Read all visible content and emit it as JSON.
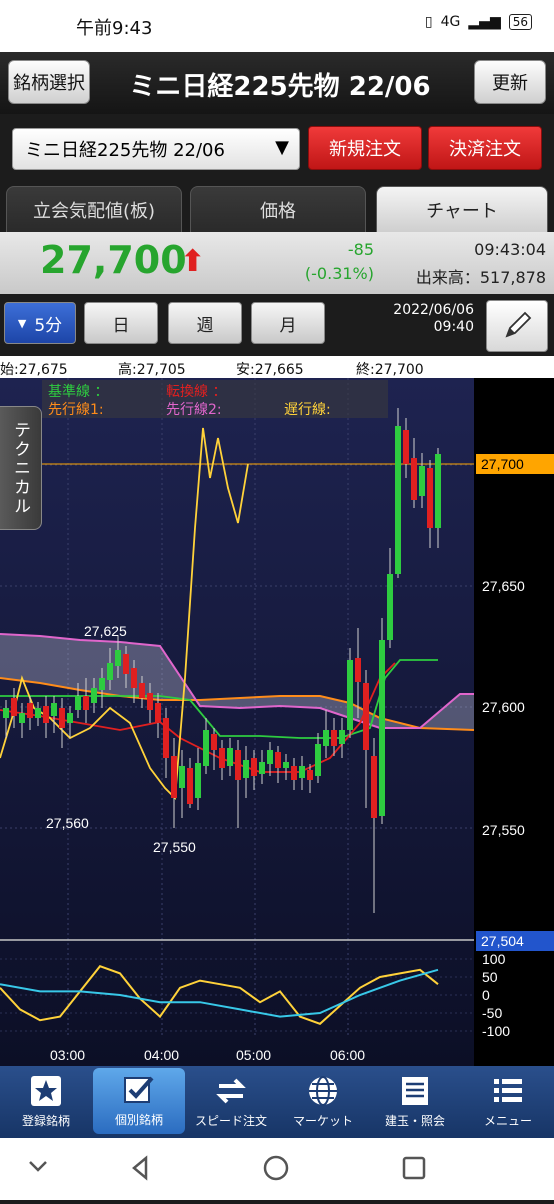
{
  "status": {
    "time": "午前9:43",
    "network": "4G",
    "battery": "56"
  },
  "header": {
    "select_button": "銘柄選択",
    "title": "ミニ日経225先物 22/06",
    "refresh_button": "更新"
  },
  "order": {
    "select_value": "ミニ日経225先物 22/06",
    "new_order": "新規注文",
    "close_order": "決済注文"
  },
  "tabs": [
    {
      "label": "立会気配値(板)"
    },
    {
      "label": "価格"
    },
    {
      "label": "チャート"
    }
  ],
  "price": {
    "last": "27,700",
    "change": "-85",
    "change_pct": "(-0.31%)",
    "time": "09:43:04",
    "volume": "出来高：517,878"
  },
  "period": {
    "buttons": [
      "5分",
      "日",
      "週",
      "月"
    ],
    "selected": "5分",
    "date": "2022/06/06",
    "time": "09:40"
  },
  "ohlc": {
    "open": "始:27,675",
    "high": "高:27,705",
    "low": "安:27,665",
    "close": "終:27,700"
  },
  "legend": {
    "kijun": "基準線 ：",
    "tenkan": "転換線 ：",
    "senkou1": "先行線1:",
    "senkou2": "先行線2:",
    "chikou": "遅行線:"
  },
  "technical_tab": "テクニカル",
  "chart_data": {
    "type": "candlestick",
    "y_ticks": [
      "27,650",
      "27,600",
      "27,550"
    ],
    "current_price_label": "27,700",
    "low_marker_label": "27,504",
    "annotations": [
      "27,625",
      "27,560",
      "27,550"
    ],
    "x_ticks": [
      "03:00",
      "04:00",
      "05:00",
      "06:00"
    ],
    "oscillator_ticks": [
      "100",
      "50",
      "0",
      "-50",
      "-100"
    ],
    "colors": {
      "up": "#2ecc40",
      "down": "#e02020",
      "kijun": "#2ecc40",
      "tenkan": "#e02020",
      "senkou1": "#ff8c1a",
      "senkou2": "#e066cc",
      "chikou": "#ffd23a",
      "osc1": "#ffd23a",
      "osc2": "#38c8e8",
      "current": "#ffa500",
      "low": "#2255cc"
    }
  },
  "bottom_nav": [
    {
      "label": "登録銘柄",
      "icon": "star-icon"
    },
    {
      "label": "個別銘柄",
      "icon": "check-icon"
    },
    {
      "label": "スピード注文",
      "icon": "arrows-icon"
    },
    {
      "label": "マーケット",
      "icon": "globe-icon"
    },
    {
      "label": "建玉・照会",
      "icon": "list-icon"
    },
    {
      "label": "メニュー",
      "icon": "menu-icon"
    }
  ]
}
